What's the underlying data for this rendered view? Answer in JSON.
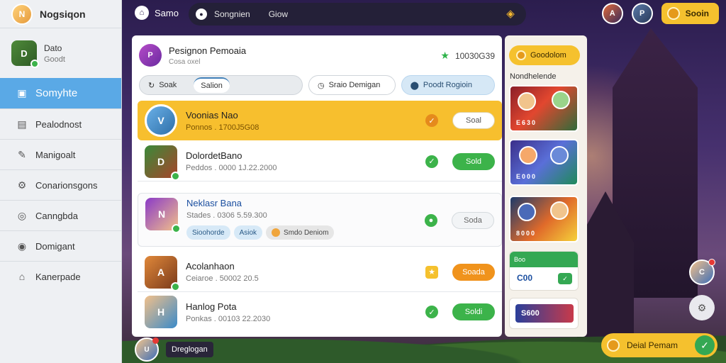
{
  "app": {
    "title": "Nogsiqon",
    "logo_initial": "N"
  },
  "sidebar": {
    "user": {
      "name": "Dato",
      "sub": "Goodt",
      "initial": "D"
    },
    "items": [
      {
        "label": "Somyhte",
        "icon": "folder-icon",
        "active": true
      },
      {
        "label": "Pealodnost",
        "icon": "document-icon"
      },
      {
        "label": "Manigoalt",
        "icon": "wrench-icon"
      },
      {
        "label": "Conarionsgons",
        "icon": "gear-icon"
      },
      {
        "label": "Canngbda",
        "icon": "globe-icon"
      },
      {
        "label": "Domigant",
        "icon": "eye-icon"
      },
      {
        "label": "Kanerpade",
        "icon": "home-icon"
      }
    ]
  },
  "topbar": {
    "home_label": "Samo",
    "search_label": "Songnien",
    "search_placeholder": "Giow",
    "gold_label": "Sooin"
  },
  "panel": {
    "title": "Pesignon Pemoaia",
    "subtitle": "Cosa oxel",
    "count": "10030G39",
    "tabs": {
      "sort_label": "Soak",
      "sort_inner": "Salion",
      "smart_label": "Sraio Demigan",
      "region_label": "Poodt Rogioin"
    },
    "rows": [
      {
        "name": "Voonias Nao",
        "meta": "Ponnos . 1700J5G08",
        "button": "Soal",
        "initial": "V"
      },
      {
        "name": "DolordetBano",
        "meta": "Peddos . 0000 1J.22.2000",
        "button": "Sold",
        "initial": "D"
      },
      {
        "name": "Neklasr Bana",
        "meta": "Stades . 0306 5.59.300",
        "button": "Soda",
        "initial": "N",
        "chips": [
          "Sioohorde",
          "Asiok",
          "Smdo Deniom"
        ]
      },
      {
        "name": "Acolanhaon",
        "meta": "Ceiaroe . 50002 20.5",
        "button": "Soada",
        "initial": "A"
      },
      {
        "name": "Hanlog Pota",
        "meta": "Ponkas . 00103 22.2030",
        "button": "Soldi",
        "initial": "H"
      }
    ]
  },
  "right": {
    "gold_label": "Goodolom",
    "caption": "Nondhelende",
    "games": [
      "E630",
      "E000",
      "8000"
    ],
    "mini_card_head": "Boo",
    "mini_card_value": "C00",
    "mini_card_value2": "S600"
  },
  "floating": {
    "detail_label": "Deial Pemam"
  },
  "bottom": {
    "label": "Dreglogan"
  },
  "colors": {
    "accent": "#5aa9e6",
    "gold": "#f5c12e",
    "green": "#3cb34a",
    "orange": "#f0931c"
  }
}
